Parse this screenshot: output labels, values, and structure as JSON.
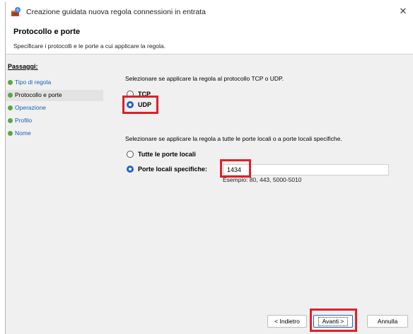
{
  "window": {
    "title": "Creazione guidata nuova regola connessioni in entrata",
    "close_glyph": "✕"
  },
  "header": {
    "title": "Protocollo e porte",
    "subtitle": "Specificare i protocolli e le porte a cui applicare la regola."
  },
  "steps": {
    "title": "Passaggi:",
    "items": [
      {
        "label": "Tipo di regola",
        "current": false
      },
      {
        "label": "Protocollo e porte",
        "current": true
      },
      {
        "label": "Operazione",
        "current": false
      },
      {
        "label": "Profilo",
        "current": false
      },
      {
        "label": "Nome",
        "current": false
      }
    ]
  },
  "protocol": {
    "question": "Selezionare se applicare la regola al protocollo TCP o UDP.",
    "tcp_label": "TCP",
    "udp_label": "UDP",
    "selected": "UDP"
  },
  "ports": {
    "question": "Selezionare se applicare la regola a tutte le porte locali o a porte locali specifiche.",
    "all_label": "Tutte le porte locali",
    "specific_label": "Porte locali specifiche:",
    "selected": "specific",
    "value": "1434",
    "example": "Esempio: 80, 443, 5000-5010"
  },
  "buttons": {
    "back": "< Indietro",
    "next": "Avanti >",
    "cancel": "Annulla"
  },
  "colors": {
    "highlight": "#e0202a",
    "radio_selected": "#1f63c6",
    "step_dot": "#5aa83c",
    "step_link": "#1a5fb4"
  }
}
